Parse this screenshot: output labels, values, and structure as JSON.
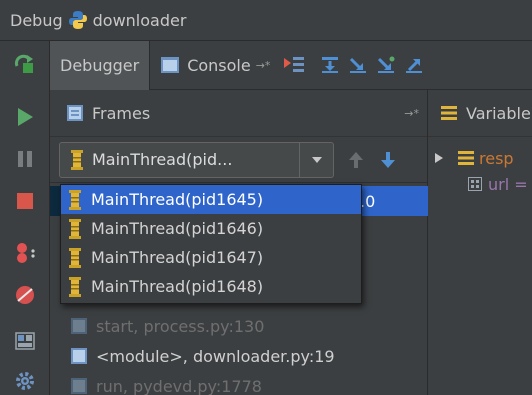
{
  "window": {
    "title_prefix": "Debug",
    "title_config": "downloader"
  },
  "tabs": {
    "debugger": "Debugger",
    "console": "Console",
    "pin_glyph": "→*"
  },
  "frames_panel": {
    "title": "Frames",
    "pin_glyph": "→*",
    "current_thread": "MainThread(pid...",
    "threads": [
      "MainThread(pid1645)",
      "MainThread(pid1646)",
      "MainThread(pid1647)",
      "MainThread(pid1648)"
    ],
    "selected_thread_index": 0,
    "selected_frame_tail": ".0",
    "frames": [
      {
        "label": "start, process.py:130",
        "style": "dim"
      },
      {
        "label": "<module>, downloader.py:19",
        "style": "bright"
      },
      {
        "label": "run, pydevd.py:1778",
        "style": "dim"
      }
    ]
  },
  "variables_panel": {
    "title": "Variable",
    "items": [
      {
        "label": "resp",
        "color": "#cc7832"
      },
      {
        "label": "url =",
        "color": "#9876aa"
      }
    ]
  },
  "colors": {
    "selection": "#2f65ca",
    "panel_bg": "#3c3f41",
    "thread_icon": "#c9a227"
  }
}
